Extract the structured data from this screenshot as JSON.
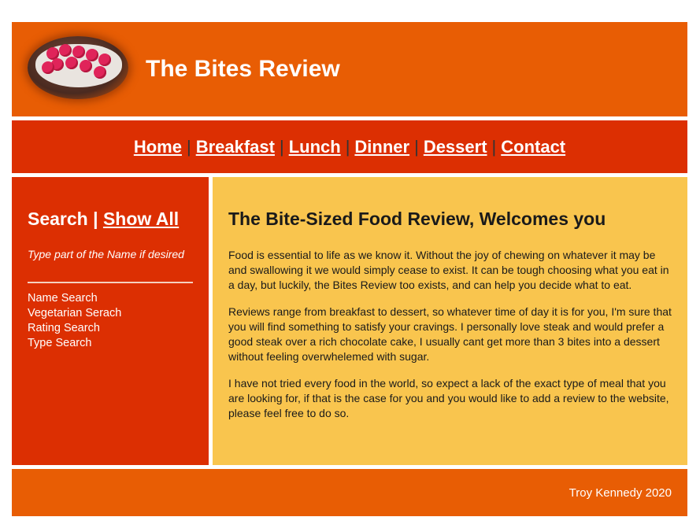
{
  "header": {
    "title": "The Bites Review",
    "logo_icon": "raspberry-bowl-icon"
  },
  "nav": {
    "items": [
      "Home",
      "Breakfast",
      "Lunch",
      "Dinner",
      "Dessert",
      "Contact"
    ],
    "separator": "|"
  },
  "sidebar": {
    "search_label": "Search",
    "separator": "|",
    "show_all_label": "Show All",
    "hint": "Type part of the Name if desired",
    "filters": [
      "Name Search",
      "Vegetarian Serach",
      "Rating Search",
      "Type Search"
    ]
  },
  "main": {
    "heading": "The Bite-Sized Food Review, Welcomes you",
    "paragraphs": [
      "Food is essential to life as we know it. Without the joy of chewing on whatever it may be and swallowing it we would simply cease to exist. It can be tough choosing what you eat in a day, but luckily, the Bites Review too exists, and can help you decide what to eat.",
      "Reviews range from breakfast to dessert, so whatever time of day it is for you, I'm sure that you will find something to satisfy your cravings. I personally love steak and would prefer a good steak over a rich chocolate cake, I usually cant get more than 3 bites into a dessert without feeling overwhelemed with sugar.",
      "I have not tried every food in the world, so expect a lack of the exact type of meal that you are looking for, if that is the case for you and you would like to add a review to the website, please feel free to do so."
    ]
  },
  "footer": {
    "text": "Troy Kennedy 2020"
  },
  "colors": {
    "orange": "#e85d04",
    "red": "#dc2f02",
    "yellow": "#f9c54e"
  }
}
